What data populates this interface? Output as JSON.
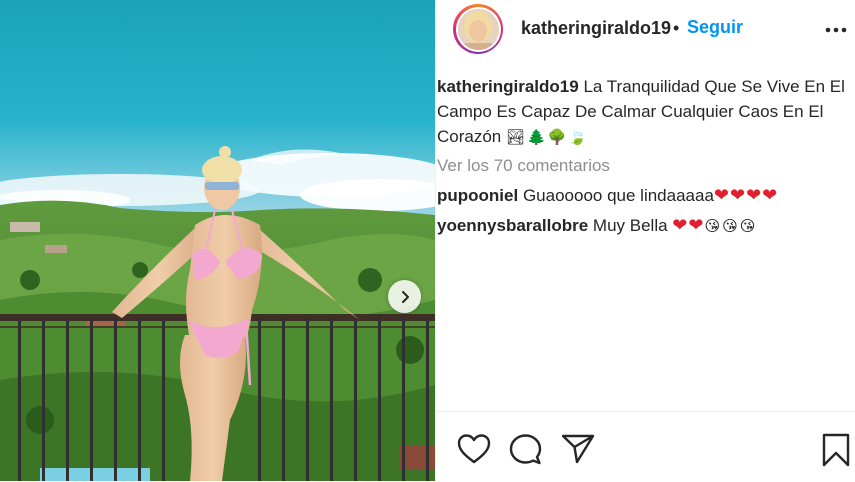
{
  "post": {
    "username": "katheringiraldo19",
    "follow_label": "Seguir",
    "separator": "•",
    "caption": {
      "text": "La Tranquilidad Que Se Vive En El Campo Es Capaz De Calmar Cualquier Caos En El Corazón",
      "emojis": "🏞🌲🌳🍃"
    },
    "view_comments_label": "Ver los 70 comentarios",
    "comments": [
      {
        "user": "pupooniel",
        "text": "Guaooooo que lindaaaaa",
        "hearts": "❤❤❤❤"
      },
      {
        "user": "yoennysbarallobre",
        "text": "Muy Bella",
        "hearts": "❤❤",
        "emojis": "😘😘😘"
      }
    ]
  },
  "icons": {
    "more": "more-options-icon",
    "like": "heart-icon",
    "comment": "comment-icon",
    "share": "send-icon",
    "save": "bookmark-icon",
    "next": "chevron-right-icon"
  },
  "colors": {
    "accent": "#0095f6",
    "text": "#262626",
    "muted": "#8e8e8e",
    "heart": "#e0202e"
  }
}
